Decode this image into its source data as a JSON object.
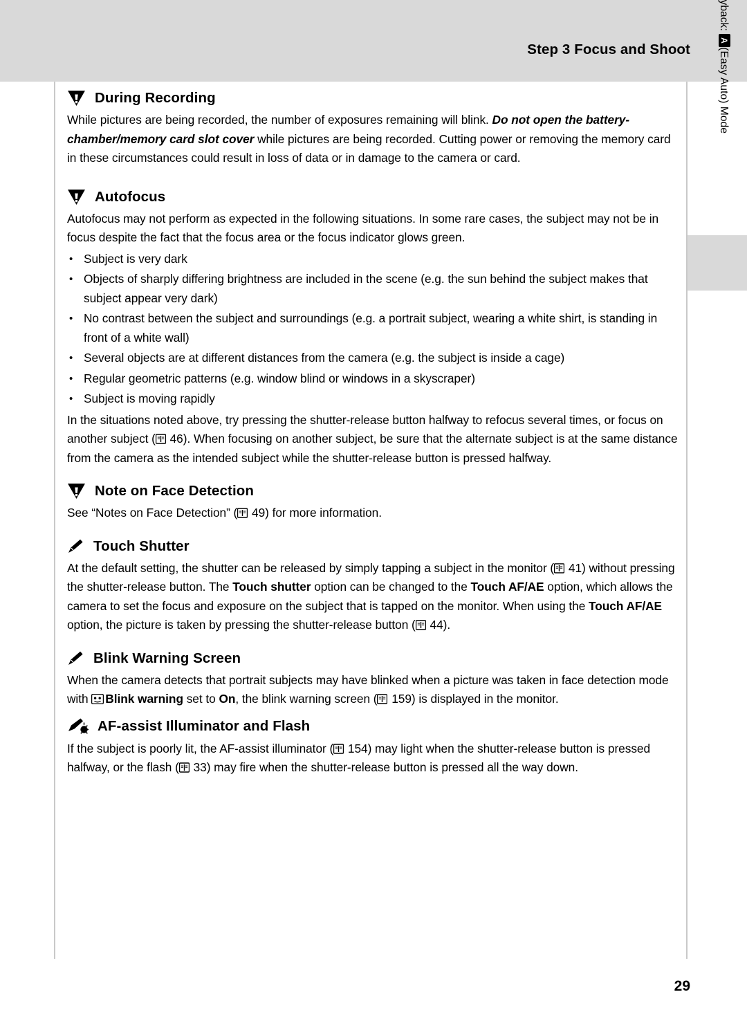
{
  "header": {
    "title": "Step 3 Focus and Shoot"
  },
  "side_tab": {
    "text_part1": "Basic Photography and Playback: ",
    "text_part2": "(Easy Auto) Mode"
  },
  "page_number": "29",
  "sections": [
    {
      "id": "during-recording",
      "icon": "warning-icon",
      "title": "During Recording",
      "paragraph_runs": [
        {
          "t": "While pictures are being recorded, the number of exposures remaining will blink. ",
          "s": "n"
        },
        {
          "t": "Do not open the battery-chamber/memory card slot cover",
          "s": "bi"
        },
        {
          "t": " while pictures are being recorded. Cutting power or removing the memory card in these circumstances could result in loss of data or in damage to the camera or card.",
          "s": "n"
        }
      ]
    },
    {
      "id": "autofocus",
      "icon": "warning-icon",
      "title": "Autofocus",
      "intro": "Autofocus may not perform as expected in the following situations. In some rare cases, the subject may not be in focus despite the fact that the focus area or the focus indicator glows green.",
      "bullets": [
        "Subject is very dark",
        "Objects of sharply differing brightness are included in the scene (e.g. the sun behind the subject makes that subject appear very dark)",
        "No contrast between the subject and surroundings (e.g. a portrait subject, wearing a white shirt, is standing in front of a white wall)",
        "Several objects are at different distances from the camera (e.g. the subject is inside a cage)",
        "Regular geometric patterns (e.g. window blind or windows in a skyscraper)",
        "Subject is moving rapidly"
      ],
      "outro_runs": [
        {
          "t": "In the situations noted above, try pressing the shutter-release button halfway to refocus several times, or focus on another subject (",
          "s": "n"
        },
        {
          "t": "BOOK",
          "s": "icon"
        },
        {
          "t": " 46). When focusing on another subject, be sure that the alternate subject is at the same distance from the camera as the intended subject while the shutter-release button is pressed halfway.",
          "s": "n"
        }
      ]
    },
    {
      "id": "note-on-face-detection",
      "icon": "warning-icon",
      "title": "Note on Face Detection",
      "paragraph_runs": [
        {
          "t": "See “Notes on Face Detection” (",
          "s": "n"
        },
        {
          "t": "BOOK",
          "s": "icon"
        },
        {
          "t": " 49) for more information.",
          "s": "n"
        }
      ]
    },
    {
      "id": "touch-shutter",
      "icon": "pencil-icon",
      "title": "Touch Shutter",
      "paragraph_runs": [
        {
          "t": "At the default setting, the shutter can be released by simply tapping a subject in the monitor (",
          "s": "n"
        },
        {
          "t": "BOOK",
          "s": "icon"
        },
        {
          "t": " 41) without pressing the shutter-release button. The ",
          "s": "n"
        },
        {
          "t": "Touch shutter",
          "s": "b"
        },
        {
          "t": " option can be changed to the ",
          "s": "n"
        },
        {
          "t": "Touch AF/AE",
          "s": "b"
        },
        {
          "t": " option, which allows the camera to set the focus and exposure on the subject that is tapped on the monitor. When using the ",
          "s": "n"
        },
        {
          "t": "Touch AF/AE",
          "s": "b"
        },
        {
          "t": " option, the picture is taken by pressing the shutter-release button (",
          "s": "n"
        },
        {
          "t": "BOOK",
          "s": "icon"
        },
        {
          "t": " 44).",
          "s": "n"
        }
      ]
    },
    {
      "id": "blink-warning-screen",
      "icon": "pencil-icon",
      "title": "Blink Warning Screen",
      "paragraph_runs": [
        {
          "t": "When the camera detects that portrait subjects may have blinked when a picture was taken in face detection mode with ",
          "s": "n"
        },
        {
          "t": "BLINK",
          "s": "blinkicon"
        },
        {
          "t": "Blink warning",
          "s": "b"
        },
        {
          "t": " set to ",
          "s": "n"
        },
        {
          "t": "On",
          "s": "b"
        },
        {
          "t": ", the blink warning screen (",
          "s": "n"
        },
        {
          "t": "BOOK",
          "s": "icon"
        },
        {
          "t": " 159) is displayed in the monitor.",
          "s": "n"
        }
      ]
    },
    {
      "id": "af-assist-illuminator-and-flash",
      "icon": "af-assist-icon",
      "title": "AF-assist Illuminator and Flash",
      "paragraph_runs": [
        {
          "t": "If the subject is poorly lit, the AF-assist illuminator (",
          "s": "n"
        },
        {
          "t": "BOOK",
          "s": "icon"
        },
        {
          "t": " 154) may light when the shutter-release button is pressed halfway, or the flash (",
          "s": "n"
        },
        {
          "t": "BOOK",
          "s": "icon"
        },
        {
          "t": " 33) may fire when the shutter-release button is pressed all the way down.",
          "s": "n"
        }
      ]
    }
  ]
}
